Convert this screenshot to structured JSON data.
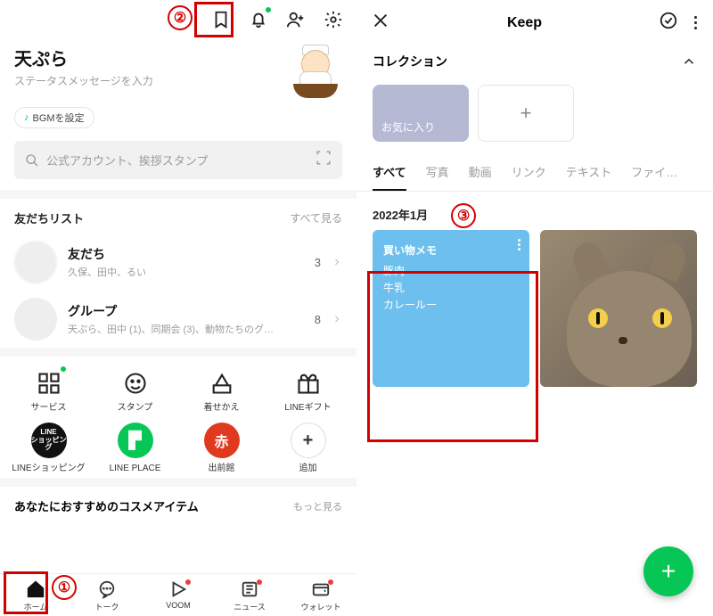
{
  "annotations": {
    "one": "①",
    "two": "②",
    "three": "③"
  },
  "left": {
    "profile_name": "天ぷら",
    "status_placeholder": "ステータスメッセージを入力",
    "bgm_label": "BGMを設定",
    "search_placeholder": "公式アカウント、挨拶スタンプ",
    "friends_section": "友だちリスト",
    "see_all": "すべて見る",
    "friends": {
      "title": "友だち",
      "sub": "久保、田中、るい",
      "count": "3"
    },
    "groups": {
      "title": "グループ",
      "sub": "天ぷら、田中 (1)、同期会 (3)、動物たちのグ…",
      "count": "8"
    },
    "grid1": [
      "サービス",
      "スタンプ",
      "着せかえ",
      "LINEギフト"
    ],
    "grid2": [
      "LINEショッピング",
      "LINE PLACE",
      "出前館",
      "追加"
    ],
    "grid2_badge": [
      "LINE\nショッピング",
      "P",
      "赤",
      "+"
    ],
    "cosme_title": "あなたにおすすめのコスメアイテム",
    "cosme_more": "もっと見る",
    "nav": [
      "ホーム",
      "トーク",
      "VOOM",
      "ニュース",
      "ウォレット"
    ]
  },
  "right": {
    "title": "Keep",
    "collection_label": "コレクション",
    "favorite": "お気に入り",
    "tabs": [
      "すべて",
      "写真",
      "動画",
      "リンク",
      "テキスト",
      "ファイ…"
    ],
    "date": "2022年1月",
    "memo": {
      "title": "買い物メモ",
      "lines": [
        "豚肉",
        "牛乳",
        "カレールー"
      ]
    }
  }
}
